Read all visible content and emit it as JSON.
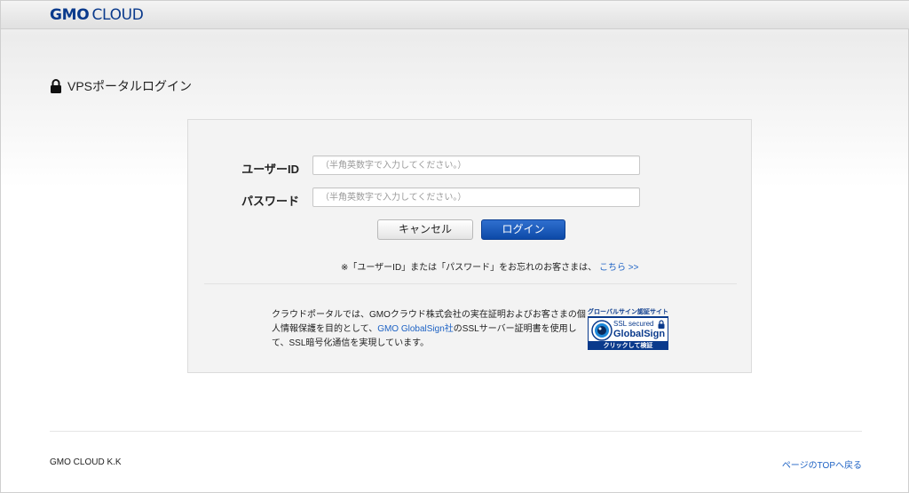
{
  "header": {
    "logo_gmo": "GMO",
    "logo_cloud": "CLOUD"
  },
  "page": {
    "title": "VPSポータルログイン"
  },
  "form": {
    "userid_label": "ユーザーID",
    "userid_placeholder": "（半角英数字で入力してください。）",
    "password_label": "パスワード",
    "password_placeholder": "（半角英数字で入力してください。）",
    "cancel_label": "キャンセル",
    "login_label": "ログイン",
    "forgot_text": "※「ユーザーID」または「パスワード」をお忘れのお客さまは、",
    "forgot_link": "こちら >>"
  },
  "ssl": {
    "text_1": "クラウドポータルでは、GMOクラウド株式会社の実在証明およびお客さまの個人情報保護を目的として、",
    "link": "GMO GlobalSign社",
    "text_2": "のSSLサーバー証明書を使用して、SSL暗号化通信を実現しています。",
    "seal_top": "グローバルサイン認証サイト",
    "seal_ssl": "SSL secured",
    "seal_brand": "GlobalSign",
    "seal_bottom": "クリックして検証"
  },
  "footer": {
    "company": "GMO CLOUD K.K",
    "to_top": "ページのTOPへ戻る"
  },
  "colors": {
    "brand": "#0a3a8c",
    "link": "#1d62c4",
    "login_button": "#0d4aa8"
  }
}
